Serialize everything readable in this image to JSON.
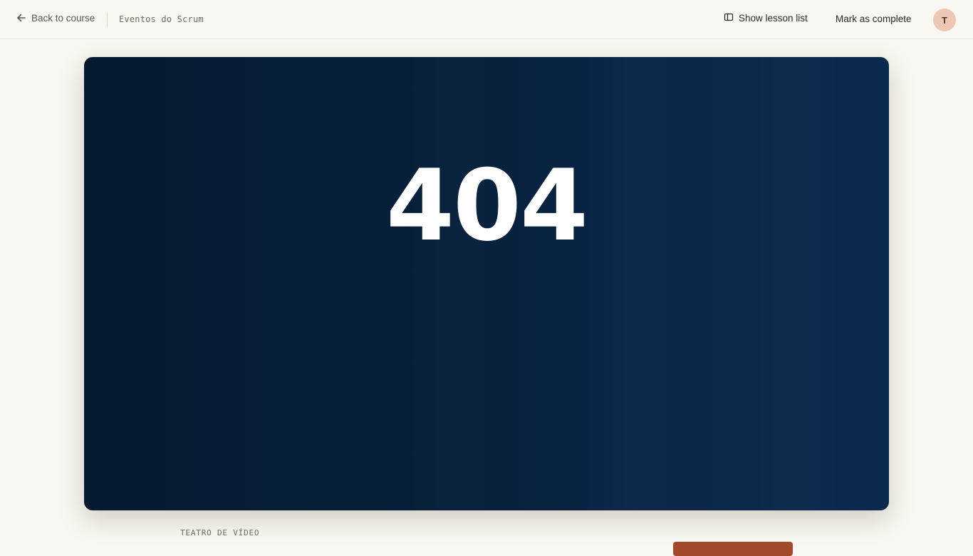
{
  "header": {
    "back_label": "Back to course",
    "lesson_title": "Eventos do Scrum",
    "show_list_label": "Show lesson list",
    "mark_complete_label": "Mark as complete",
    "avatar_initial": "T"
  },
  "player": {
    "error_code": "404"
  },
  "below": {
    "section_label": "TEATRO DE VÍDEO"
  },
  "colors": {
    "page_bg": "#faf7f2",
    "player_bg": "#07203b",
    "avatar_bg": "#ecc7b5",
    "accent": "#a2482b"
  },
  "icons": {
    "back": "arrow-left-icon",
    "lesson_list": "sidebar-panel-icon"
  }
}
